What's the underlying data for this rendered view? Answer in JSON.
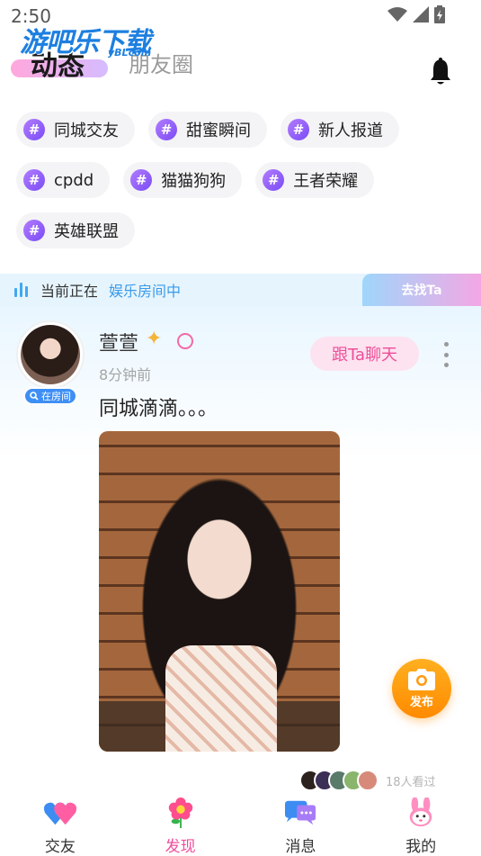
{
  "status_bar": {
    "time": "2:50"
  },
  "watermark": {
    "main": "游吧乐下载",
    "sub": "yBLcom"
  },
  "header": {
    "tab_active": "动态",
    "tab_inactive": "朋友圈"
  },
  "topics": [
    {
      "label": "同城交友"
    },
    {
      "label": "甜蜜瞬间"
    },
    {
      "label": "新人报道"
    },
    {
      "label": "cpdd"
    },
    {
      "label": "猫猫狗狗"
    },
    {
      "label": "王者荣耀"
    },
    {
      "label": "英雄联盟"
    }
  ],
  "topic_hash_glyph": "#",
  "now_bar": {
    "label": "当前正在",
    "room": "娱乐房间中",
    "action": "去找Ta"
  },
  "post": {
    "user_name": "萱萱",
    "in_room_badge": "在房间",
    "time_ago": "8分钟前",
    "chat_button": "跟Ta聊天",
    "text": "同城滴滴。。。",
    "viewer_count": "18人看过"
  },
  "fab": {
    "label": "发布"
  },
  "bottom_nav": [
    {
      "label": "交友",
      "icon": "hearts-icon",
      "active": false
    },
    {
      "label": "发现",
      "icon": "flower-icon",
      "active": true
    },
    {
      "label": "消息",
      "icon": "chat-bubbles-icon",
      "active": false
    },
    {
      "label": "我的",
      "icon": "bunny-icon",
      "active": false
    }
  ],
  "colors": {
    "accent_pink": "#ef4f9d",
    "accent_blue": "#3a9bea",
    "fab_orange": "#ff9a10",
    "topic_purple": "#8a55f7"
  }
}
